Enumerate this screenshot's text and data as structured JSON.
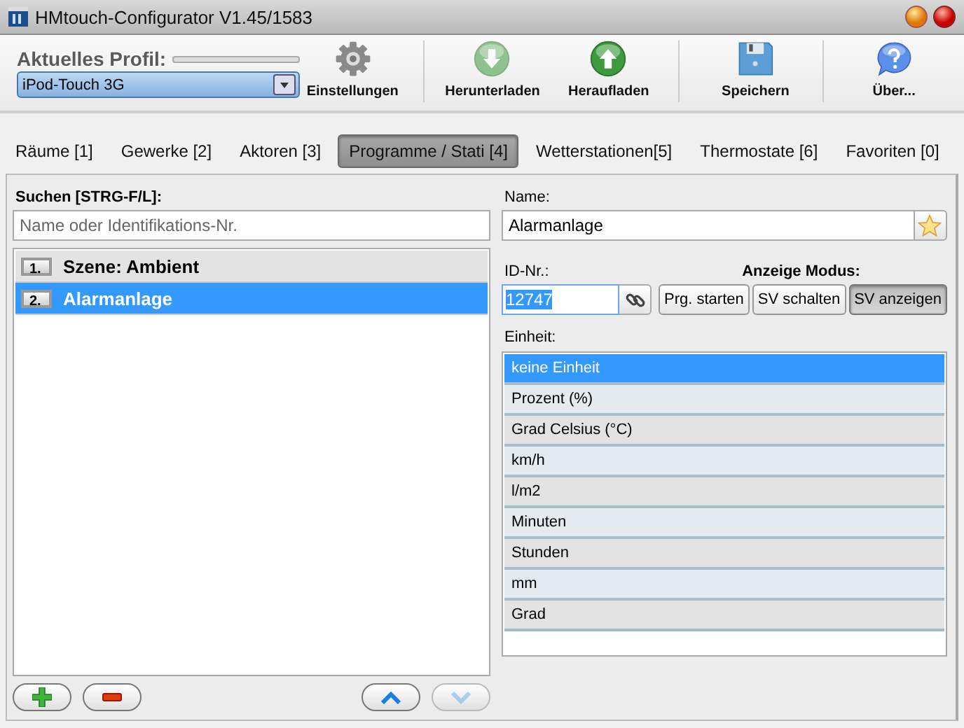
{
  "window": {
    "title": "HMtouch-Configurator V1.45/1583"
  },
  "toolbar": {
    "profile_label": "Aktuelles Profil:",
    "profile_value": "iPod-Touch 3G",
    "tools": [
      {
        "kind": "settings",
        "label": "Einstellungen",
        "disabled": false
      },
      {
        "kind": "download",
        "label": "Herunterladen",
        "disabled": true
      },
      {
        "kind": "upload",
        "label": "Heraufladen",
        "disabled": false
      },
      {
        "kind": "save",
        "label": "Speichern",
        "disabled": false
      },
      {
        "kind": "about",
        "label": "Über...",
        "disabled": false
      }
    ]
  },
  "tabs": [
    {
      "label": "Räume [1]",
      "selected": false
    },
    {
      "label": "Gewerke [2]",
      "selected": false
    },
    {
      "label": "Aktoren [3]",
      "selected": false
    },
    {
      "label": "Programme / Stati [4]",
      "selected": true
    },
    {
      "label": "Wetterstationen[5]",
      "selected": false
    },
    {
      "label": "Thermostate [6]",
      "selected": false
    },
    {
      "label": "Favoriten [0]",
      "selected": false
    }
  ],
  "search": {
    "label": "Suchen [STRG-F/L]:",
    "placeholder": "Name oder Identifikations-Nr."
  },
  "programs": [
    {
      "number": "1.",
      "name": "Szene: Ambient",
      "selected": false
    },
    {
      "number": "2.",
      "name": "Alarmanlage",
      "selected": true
    }
  ],
  "list_buttons": [
    {
      "kind": "add",
      "disabled": false
    },
    {
      "kind": "remove",
      "disabled": false
    },
    {
      "kind": "up",
      "disabled": false
    },
    {
      "kind": "down",
      "disabled": true
    }
  ],
  "details": {
    "name_label": "Name:",
    "name_value": "Alarmanlage",
    "id_label": "ID-Nr.:",
    "id_value": "12747",
    "mode_label": "Anzeige Modus:",
    "mode_buttons": [
      {
        "label": "Prg. starten",
        "selected": false
      },
      {
        "label": "SV schalten",
        "selected": false
      },
      {
        "label": "SV anzeigen",
        "selected": true
      }
    ],
    "unit_label": "Einheit:",
    "units": [
      {
        "label": "keine Einheit",
        "selected": true
      },
      {
        "label": "Prozent (%)",
        "selected": false
      },
      {
        "label": "Grad Celsius (°C)",
        "selected": false
      },
      {
        "label": "km/h",
        "selected": false
      },
      {
        "label": "l/m2",
        "selected": false
      },
      {
        "label": "Minuten",
        "selected": false
      },
      {
        "label": "Stunden",
        "selected": false
      },
      {
        "label": "mm",
        "selected": false
      },
      {
        "label": "Grad",
        "selected": false
      }
    ]
  }
}
